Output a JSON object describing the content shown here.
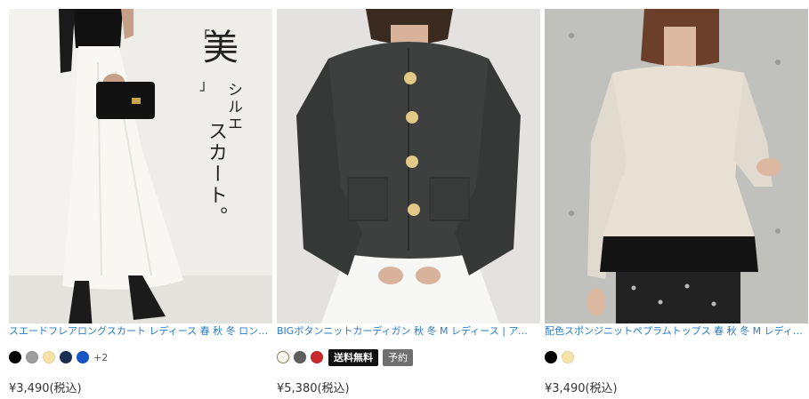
{
  "products": [
    {
      "title": "スエードフレアロングスカート レディース 春 秋 冬 ロング丈 …",
      "overlay_text": {
        "big": "美",
        "line1": "シルエ",
        "line2": "スカート。"
      },
      "colors": [
        "#000000",
        "#9e9e9e",
        "#f7e3a8",
        "#1b2f55",
        "#1a56c8"
      ],
      "more_colors": "+2",
      "tags": [],
      "price": "¥3,490(税込)"
    },
    {
      "title": "BIGボタンニットカーディガン 秋 冬 M レディース | アクアガ…",
      "colors": [
        "#fdfaf0",
        "#5f5f5f",
        "#c8282c"
      ],
      "more_colors": "",
      "tags": [
        {
          "label": "送料無料",
          "color": "#111111"
        },
        {
          "label": "予約",
          "color": "#6f6f6f"
        }
      ],
      "price": "¥5,380(税込)"
    },
    {
      "title": "配色スポンジニットペプラムトップス 春 秋 冬 M レディース |…",
      "colors": [
        "#000000",
        "#f7e3a8"
      ],
      "more_colors": "",
      "tags": [],
      "price": "¥3,490(税込)"
    }
  ]
}
